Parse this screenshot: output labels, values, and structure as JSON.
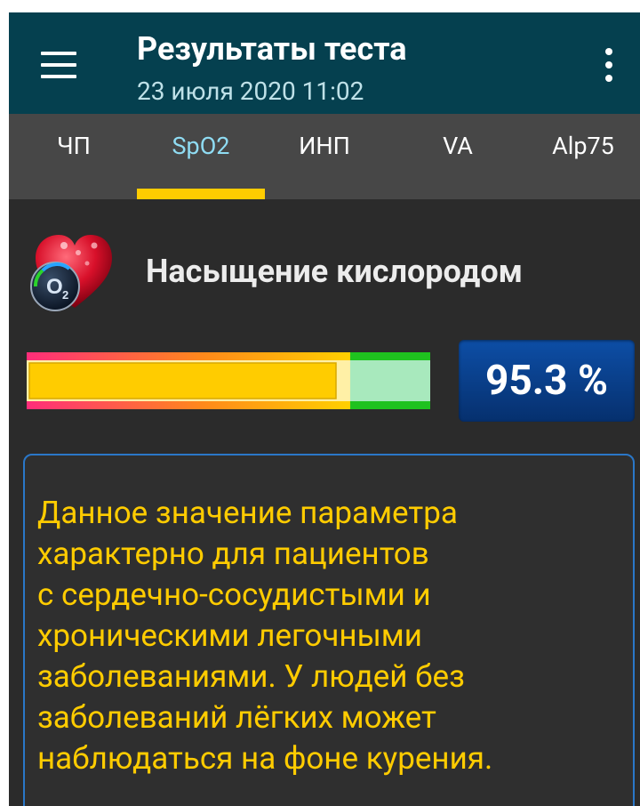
{
  "appbar": {
    "title": "Результаты теста",
    "subtitle": "23 июля 2020  11:02",
    "menu_icon": "hamburger-menu-icon",
    "more_icon": "more-vertical-icon",
    "background": "#05404f"
  },
  "tabs": [
    {
      "label": "ЧП",
      "active": false
    },
    {
      "label": "SpO2",
      "active": true
    },
    {
      "label": "ИНП",
      "active": false
    },
    {
      "label": "VA",
      "active": false
    },
    {
      "label": "Alp75",
      "active": false
    }
  ],
  "indicator_color": "#ffcc00",
  "main": {
    "icon": "oxygen-heart-icon",
    "heading": "Насыщение кислородом",
    "level": {
      "value_text": "95.3 %",
      "fill_fraction": 0.76,
      "colors": {
        "low": "#ff2d7a",
        "mid": "#ffd000",
        "high": "#22c322"
      }
    },
    "description": "Данное значение параметра\nхарактерно для пациентов\nс сердечно-сосудистыми и\nхроническими легочными\nзаболеваниями. У людей без\nзаболеваний лёгких может\nнаблюдаться на фоне курения."
  }
}
